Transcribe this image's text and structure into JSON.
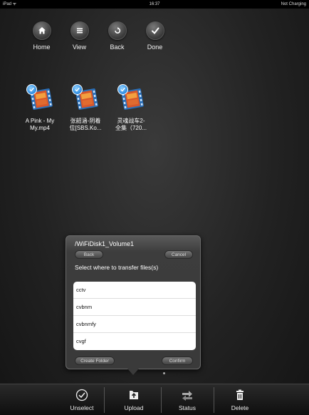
{
  "statusbar": {
    "carrier": "iPad ᯤ",
    "time": "16:37",
    "battery": "Not Charging"
  },
  "toolbar": {
    "items": [
      {
        "label": "Home",
        "icon": "home-icon"
      },
      {
        "label": "View",
        "icon": "list-icon"
      },
      {
        "label": "Back",
        "icon": "back-arrow-icon"
      },
      {
        "label": "Done",
        "icon": "checkmark-icon"
      }
    ]
  },
  "files": [
    {
      "name_line1": "A Pink - My",
      "name_line2": "My.mp4",
      "selected": true
    },
    {
      "name_line1": "张韶涵-阴着",
      "name_line2": "位[SBS.Ko...",
      "selected": true
    },
    {
      "name_line1": "灵魂战车2-",
      "name_line2": "全集（720...",
      "selected": true
    }
  ],
  "popup": {
    "title": "/WiFiDisk1_Volume1",
    "back_label": "Back",
    "cancel_label": "Cancel",
    "prompt": "Select where to transfer files(s)",
    "folders": [
      "cctv",
      "cvbnm",
      "cvbnmfy",
      "cvgf"
    ],
    "create_folder_label": "Create Folder",
    "confirm_label": "Confirm"
  },
  "tabbar": {
    "items": [
      {
        "label": "Unselect",
        "icon": "unselect-check-icon"
      },
      {
        "label": "Upload",
        "icon": "upload-icon"
      },
      {
        "label": "Status",
        "icon": "transfer-status-icon"
      },
      {
        "label": "Delete",
        "icon": "trash-icon"
      }
    ]
  },
  "colors": {
    "background": "#222222",
    "check_blue": "#2c8be0",
    "list_bg": "#ffffff"
  }
}
